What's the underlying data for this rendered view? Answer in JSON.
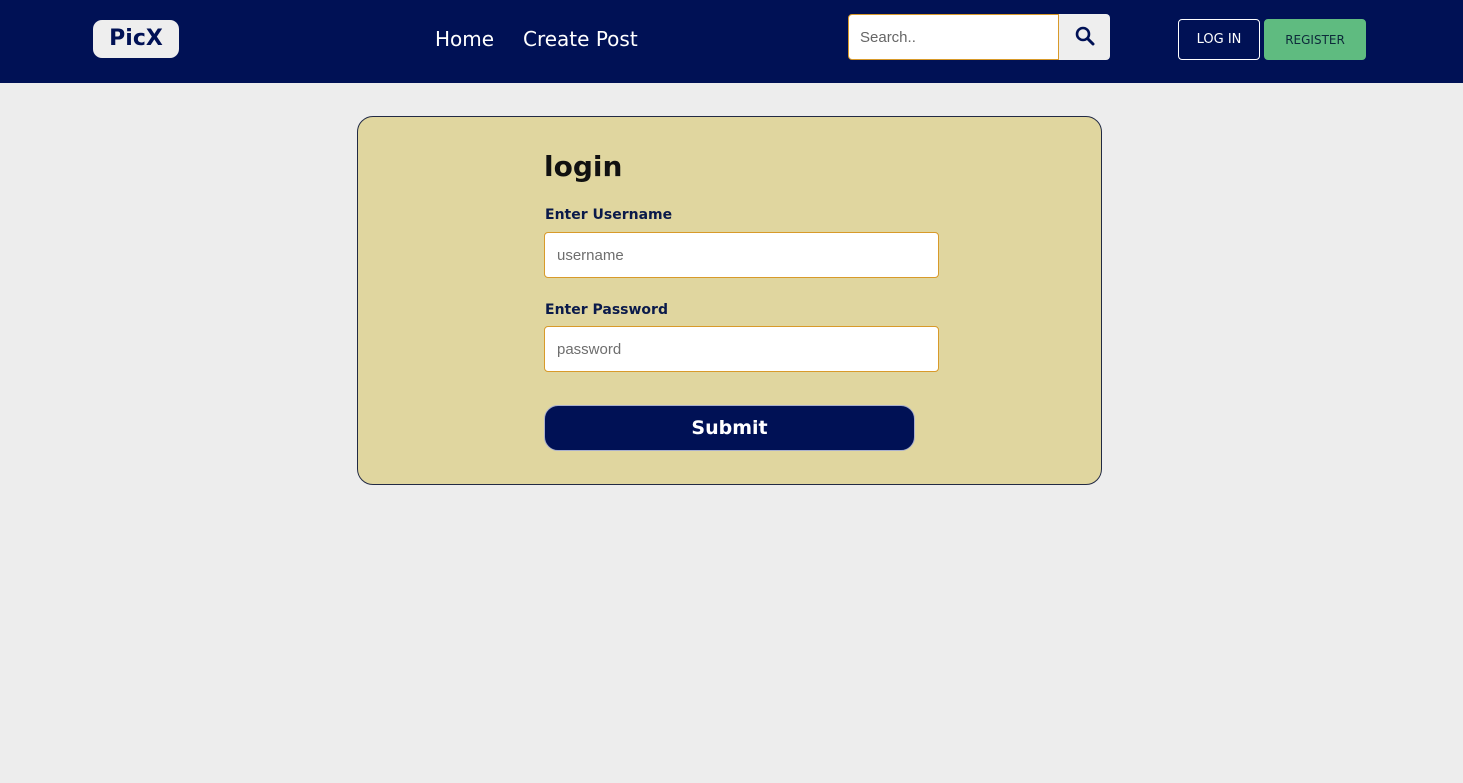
{
  "navbar": {
    "brand": "PicX",
    "links": [
      {
        "label": "Home"
      },
      {
        "label": "Create Post"
      }
    ],
    "search": {
      "placeholder": "Search..",
      "value": ""
    },
    "login_label": "LOG IN",
    "register_label": "REGISTER"
  },
  "login_form": {
    "title": "login",
    "username_label": "Enter Username",
    "username_placeholder": "username",
    "username_value": "",
    "password_label": "Enter Password",
    "password_placeholder": "password",
    "password_value": "",
    "submit_label": "Submit"
  },
  "icons": {
    "search": "search-icon"
  },
  "colors": {
    "navbar_bg": "#001155",
    "page_bg": "#ededed",
    "card_bg": "#e0d69f",
    "input_border": "#d89a2a",
    "register_bg": "#5fbb80"
  }
}
